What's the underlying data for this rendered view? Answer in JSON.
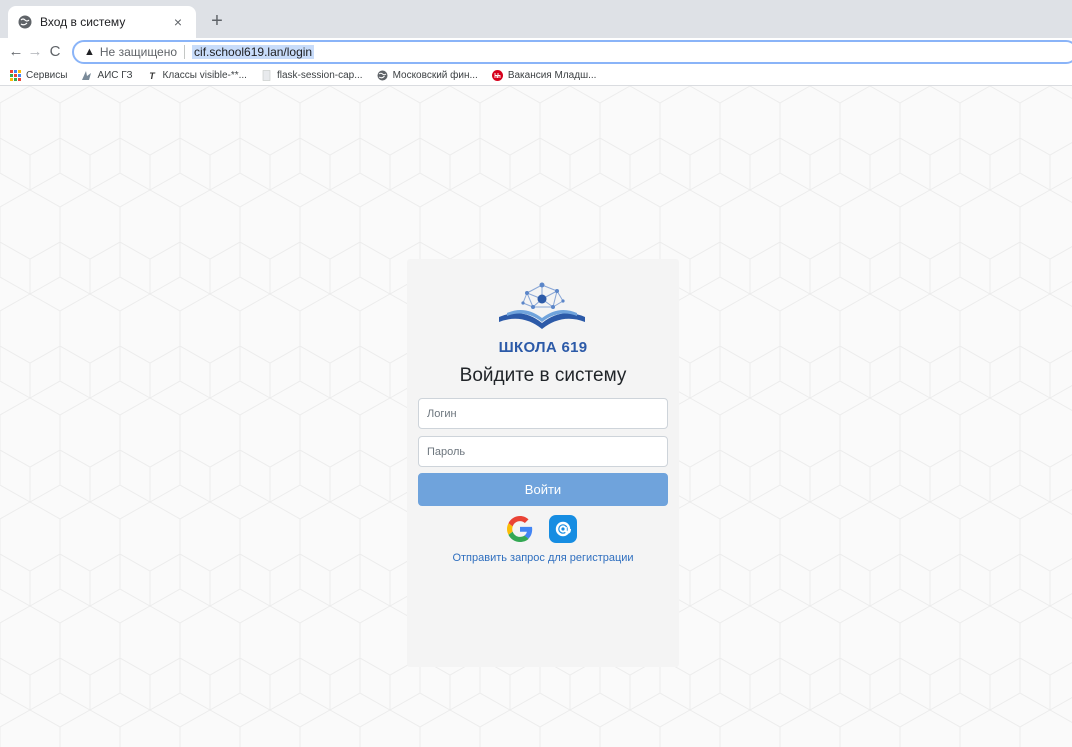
{
  "browser": {
    "tab_title": "Вход в систему",
    "tab_close": "×",
    "new_tab": "+",
    "nav_back": "←",
    "nav_forward": "→",
    "nav_reload": "C",
    "security_warning_icon": "▲",
    "security_label": "Не защищено",
    "url": "cif.school619.lan/login"
  },
  "bookmarks": [
    {
      "label": "Сервисы",
      "icon": "apps-grid-icon"
    },
    {
      "label": "АИС ГЗ",
      "icon": "ais-icon"
    },
    {
      "label": "Классы visible-**...",
      "icon": "tex-icon"
    },
    {
      "label": "flask-session-cap...",
      "icon": "page-icon"
    },
    {
      "label": "Московский фин...",
      "icon": "globe-icon"
    },
    {
      "label": "Вакансия Младш...",
      "icon": "hh-icon"
    }
  ],
  "login": {
    "brand": "ШКОЛА 619",
    "heading": "Войдите в систему",
    "login_placeholder": "Логин",
    "password_placeholder": "Пароль",
    "submit_label": "Войти",
    "register_link": "Отправить запрос для регистрации"
  },
  "colors": {
    "primary_button": "#6fa3dc",
    "brand_blue": "#2c5aa8",
    "link": "#2f6fbf",
    "card_bg": "#f4f4f4"
  }
}
